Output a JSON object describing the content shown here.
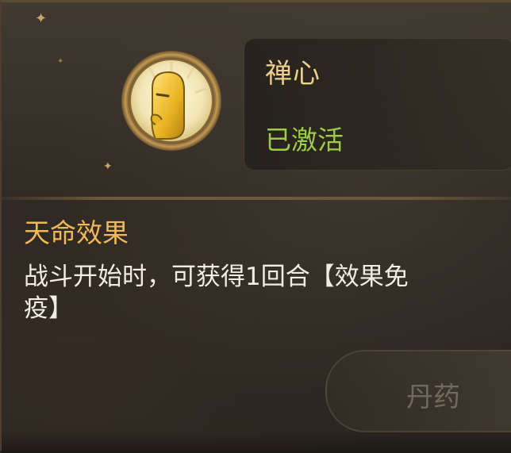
{
  "talent": {
    "name": "禅心",
    "status": "已激活",
    "icon": "monk-emblem-icon"
  },
  "effect": {
    "title": "天命效果",
    "description_line1": "战斗开始时，可获得1回合【效果免",
    "description_line2": "疫】"
  },
  "side_button": {
    "label": "丹药"
  },
  "colors": {
    "title": "#f0cf8e",
    "status_active": "#9ccc4a",
    "section_title": "#f0b85a",
    "description": "#f2ece2"
  }
}
